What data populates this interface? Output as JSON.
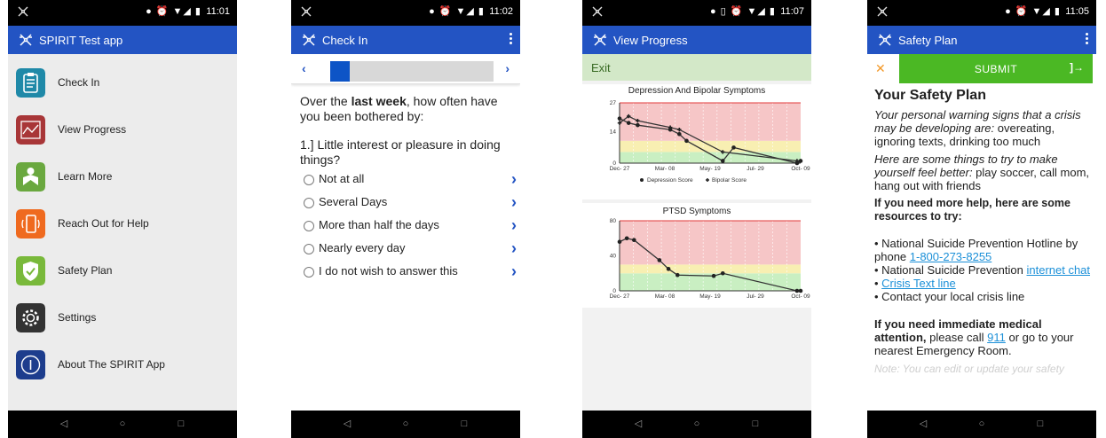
{
  "colors": {
    "appbar": "#2354c3",
    "status_bar": "#000000",
    "chart_red": "#f6c6c7",
    "chart_yellow": "#f8efb2",
    "chart_green": "#c9efc2",
    "submit_green": "#4bb824",
    "exit_green": "#d3e8c8",
    "link_blue": "#1c90d8"
  },
  "phone1": {
    "status_time": "11:01",
    "title": "SPIRIT Test app",
    "menu": [
      {
        "label": "Check In",
        "icon": "clipboard-icon",
        "color": "#1f89a8"
      },
      {
        "label": "View Progress",
        "icon": "chart-icon",
        "color": "#a83638"
      },
      {
        "label": "Learn More",
        "icon": "reading-person-icon",
        "color": "#6aa83f"
      },
      {
        "label": "Reach Out for Help",
        "icon": "phone-ring-icon",
        "color": "#ef6a1f"
      },
      {
        "label": "Safety Plan",
        "icon": "shield-check-icon",
        "color": "#79b93b"
      },
      {
        "label": "Settings",
        "icon": "gear-icon",
        "color": "#333333"
      },
      {
        "label": "About The SPIRIT App",
        "icon": "info-icon",
        "color": "#1d3d8d"
      }
    ]
  },
  "phone2": {
    "status_time": "11:02",
    "title": "Check In",
    "progress_fraction": 0.12,
    "question_intro_before": "Over the ",
    "question_intro_bold": "last week",
    "question_intro_after": ", how often have you been bothered by:",
    "question": "1.] Little interest or pleasure in doing things?",
    "options": [
      "Not at all",
      "Several Days",
      "More than half the days",
      "Nearly every day",
      "I do not wish to answer this"
    ]
  },
  "phone3": {
    "status_time": "11:07",
    "title": "View Progress",
    "exit_label": "Exit",
    "charts": [
      {
        "type": "line",
        "title": "Depression And Bipolar Symptoms",
        "x_ticks": [
          "Dec- 27",
          "Mar- 08",
          "May- 19",
          "Jul- 29",
          "Oct- 09"
        ],
        "y_ticks": [
          "27",
          "14",
          "0"
        ],
        "ylim": [
          0,
          27
        ],
        "bands": [
          {
            "from": 0,
            "to": 5,
            "color": "green"
          },
          {
            "from": 5,
            "to": 10,
            "color": "yellow"
          },
          {
            "from": 10,
            "to": 27,
            "color": "red"
          }
        ],
        "legend": [
          "Depression Score",
          "Bipolar Score"
        ],
        "series": [
          {
            "name": "Depression Score",
            "x": [
              0,
              0.05,
              0.1,
              0.28,
              0.33,
              0.37,
              0.57,
              0.63,
              0.98,
              1.0
            ],
            "y": [
              20,
              18,
              17,
              15,
              13,
              10,
              1,
              7,
              0,
              1
            ]
          },
          {
            "name": "Bipolar Score",
            "x": [
              0,
              0.05,
              0.1,
              0.28,
              0.33,
              0.57,
              0.98
            ],
            "y": [
              18,
              21,
              19,
              16,
              15,
              5,
              1
            ]
          }
        ]
      },
      {
        "type": "line",
        "title": "PTSD Symptoms",
        "x_ticks": [
          "Dec- 27",
          "Mar- 08",
          "May- 19",
          "Jul- 29",
          "Oct- 09"
        ],
        "y_ticks": [
          "80",
          "40",
          "0"
        ],
        "ylim": [
          0,
          80
        ],
        "bands": [
          {
            "from": 0,
            "to": 20,
            "color": "green"
          },
          {
            "from": 20,
            "to": 30,
            "color": "yellow"
          },
          {
            "from": 30,
            "to": 80,
            "color": "red"
          }
        ],
        "series": [
          {
            "name": "",
            "x": [
              0,
              0.04,
              0.08,
              0.22,
              0.27,
              0.32,
              0.52,
              0.57,
              0.98,
              1.0
            ],
            "y": [
              56,
              60,
              58,
              35,
              25,
              18,
              17,
              20,
              0,
              0
            ]
          }
        ]
      }
    ]
  },
  "phone4": {
    "status_time": "11:05",
    "title": "Safety Plan",
    "submit_label": "SUBMIT",
    "heading": "Your Safety Plan",
    "warning_prompt": "Your personal warning signs that a crisis may be developing  are:",
    "warning_answer": " overeating, ignoring texts, drinking too much",
    "coping_prompt": "Here are some things to try to make yourself feel better:",
    "coping_answer": " play soccer, call mom, hang out with friends",
    "more_help": "If you need more help, here are some resources to try:",
    "res1_text": "• National Suicide Prevention Hotline by phone ",
    "res1_link": "1-800-273-8255",
    "res2_text": "• National Suicide Prevention ",
    "res2_link": "internet chat",
    "res3_bullet": "• ",
    "res3_link": "Crisis Text line",
    "res4_text": "• Contact your local crisis line",
    "emergency_bold": "If you need immediate medical attention,",
    "emergency_text1": " please call ",
    "emergency_link": "911",
    "emergency_text2": " or go to your nearest Emergency Room.",
    "note": "Note: You can edit or update your safety"
  }
}
